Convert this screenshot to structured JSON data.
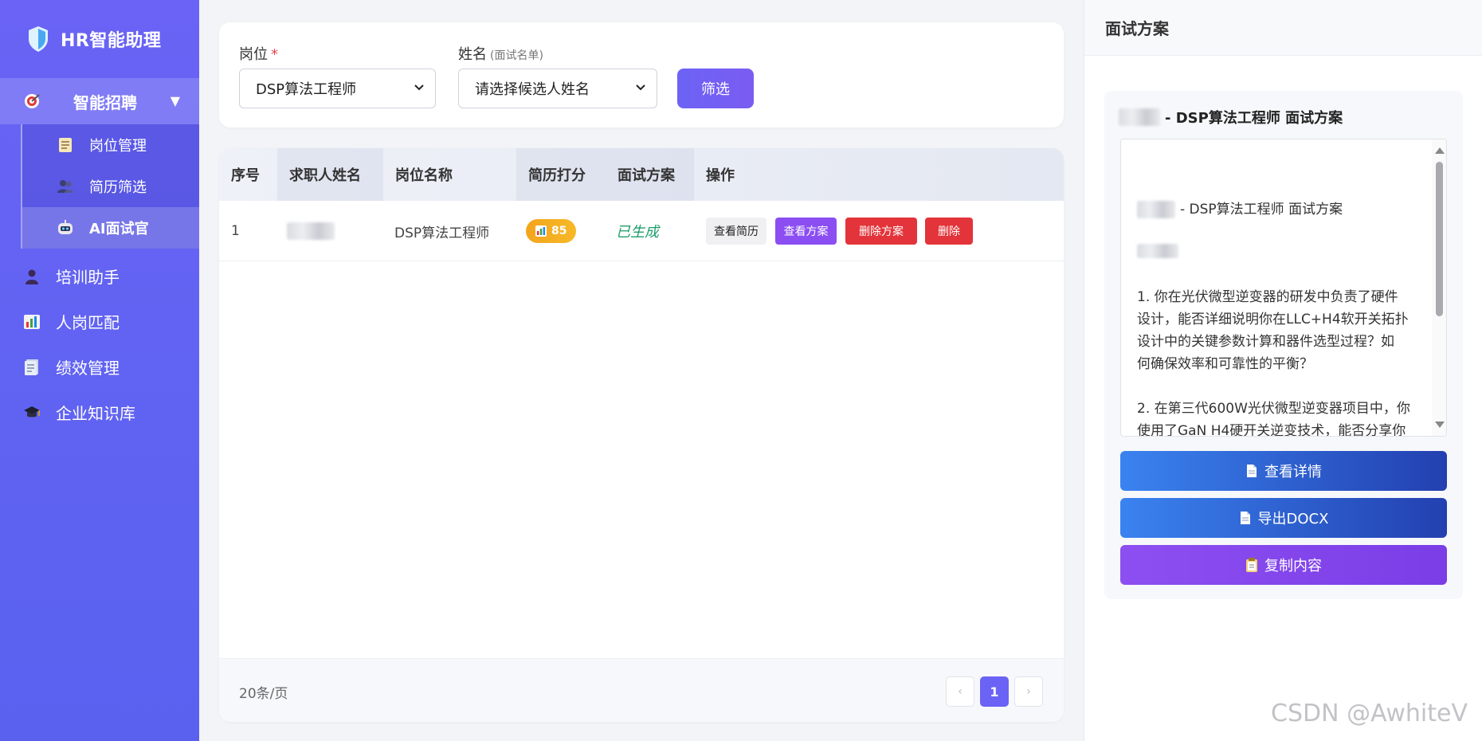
{
  "sidebar": {
    "brand": "HR智能助理",
    "recruit": {
      "label": "智能招聘",
      "caret": "▼"
    },
    "sub_items": [
      {
        "label": "岗位管理"
      },
      {
        "label": "简历筛选"
      },
      {
        "label": "AI面试官"
      }
    ],
    "items": [
      {
        "label": "培训助手"
      },
      {
        "label": "人岗匹配"
      },
      {
        "label": "绩效管理"
      },
      {
        "label": "企业知识库"
      }
    ]
  },
  "filter": {
    "position_label": "岗位",
    "required_mark": "*",
    "position_value": "DSP算法工程师",
    "name_label": "姓名",
    "name_hint": "(面试名单)",
    "name_placeholder": "请选择候选人姓名",
    "button": "筛选"
  },
  "table": {
    "headers": [
      "序号",
      "求职人姓名",
      "岗位名称",
      "简历打分",
      "面试方案",
      "操作"
    ],
    "rows": [
      {
        "index": "1",
        "position": "DSP算法工程师",
        "score": "85",
        "plan_status": "已生成",
        "actions": [
          "查看简历",
          "查看方案",
          "删除方案",
          "删除"
        ]
      }
    ],
    "page_size": "20条/页",
    "prev": "‹",
    "current_page": "1",
    "next": "›"
  },
  "panel": {
    "title": "面试方案",
    "plan_title": "- DSP算法工程师 面试方案",
    "plan_heading": "- DSP算法工程师 面试方案",
    "plan_lines": [
      "1. 你在光伏微型逆变器的研发中负责了硬件",
      "设计，能否详细说明你在LLC+H4软开关拓扑",
      "设计中的关键参数计算和器件选型过程？如",
      "何确保效率和可靠性的平衡？",
      "2. 在第三代600W光伏微型逆变器项目中，你",
      "使用了GaN H4硬开关逆变技术，能否分享你"
    ],
    "buttons": [
      "查看详情",
      "导出DOCX",
      "复制内容"
    ]
  },
  "watermark": "CSDN @AwhiteV"
}
